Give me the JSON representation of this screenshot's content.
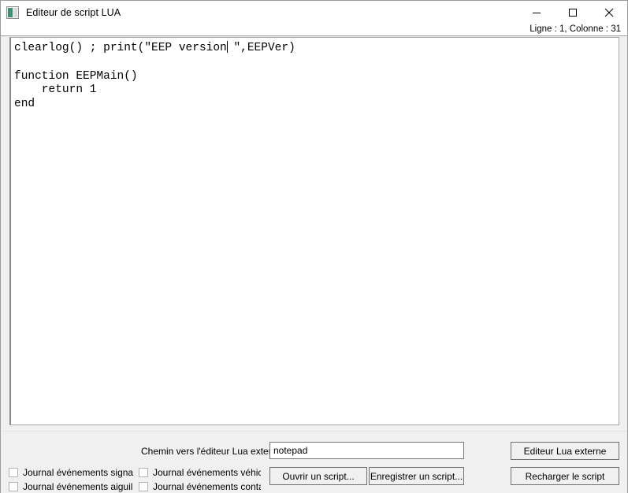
{
  "window": {
    "title": "Editeur de script LUA",
    "icon": "app-window-icon",
    "controls": {
      "minimize": "minimize-icon",
      "maximize": "maximize-icon",
      "close": "close-icon"
    }
  },
  "status": {
    "line_column": "Ligne : 1, Colonne : 31"
  },
  "editor": {
    "code_before_caret": "clearlog() ; print(\"EEP version",
    "code_after_caret": " \",EEPVer)\n\nfunction EEPMain()\n    return 1\nend"
  },
  "bottom": {
    "path_label": "Chemin vers l'éditeur Lua externe",
    "path_value": "notepad",
    "path_placeholder": "",
    "checkboxes": [
      {
        "label": "Journal événements signalisa",
        "checked": false
      },
      {
        "label": "Journal événements aiguillag",
        "checked": false
      },
      {
        "label": "Journal événements véhicule",
        "checked": false
      },
      {
        "label": "Journal événements contacts",
        "checked": false
      }
    ],
    "buttons": {
      "open_script": "Ouvrir un script...",
      "save_script": "Enregistrer un script...",
      "external_editor": "Editeur Lua externe",
      "reload_script": "Recharger le script"
    }
  },
  "colors": {
    "window_bg": "#f0f0f0",
    "titlebar_bg": "#ffffff",
    "editor_bg": "#ffffff",
    "icon_accent": "#3f8f74"
  }
}
